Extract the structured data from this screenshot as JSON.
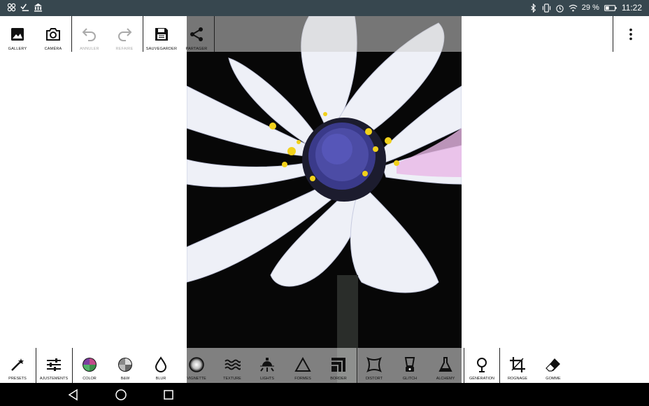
{
  "status_bar": {
    "battery": "29 %",
    "time": "11:22"
  },
  "top_toolbar": {
    "gallery": "GALLERY",
    "camera": "CAMÉRA",
    "undo": "ANNULER",
    "redo": "REFAIRE",
    "save": "SAUVEGARDER",
    "share": "PARTAGER"
  },
  "bottom_toolbar": [
    {
      "label": "PRESETS",
      "icon": "magic-wand-icon"
    },
    {
      "label": "AJUSTEMENTS",
      "icon": "sliders-icon"
    },
    {
      "label": "COLOR",
      "icon": "color-icon"
    },
    {
      "label": "B&W",
      "icon": "bw-icon"
    },
    {
      "label": "BLUR",
      "icon": "drop-icon"
    },
    {
      "label": "VIGNETTE",
      "icon": "vignette-icon"
    },
    {
      "label": "TEXTURE",
      "icon": "texture-icon"
    },
    {
      "label": "LIGHTS",
      "icon": "lights-icon"
    },
    {
      "label": "FORMES",
      "icon": "triangle-icon"
    },
    {
      "label": "BORDER",
      "icon": "border-icon"
    },
    {
      "label": "DISTORT",
      "icon": "distort-icon"
    },
    {
      "label": "GLITCH",
      "icon": "blender-icon"
    },
    {
      "label": "ALCHEMY",
      "icon": "flask-icon"
    },
    {
      "label": "GÉNÉRATION",
      "icon": "tree-icon"
    },
    {
      "label": "ROGNAGE",
      "icon": "crop-icon"
    },
    {
      "label": "GOMME",
      "icon": "eraser-icon"
    }
  ],
  "colors": {
    "status_bar": "#37474f",
    "nav_bar": "#000000",
    "background": "#ffffff"
  }
}
